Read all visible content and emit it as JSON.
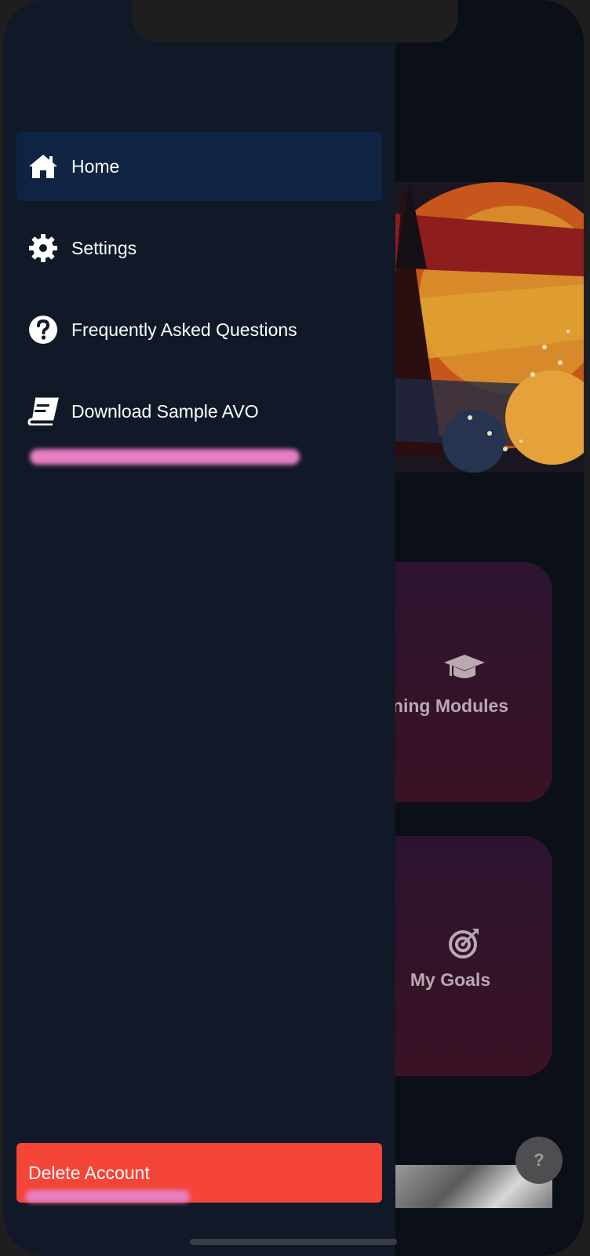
{
  "drawer": {
    "items": [
      {
        "label": "Home",
        "icon": "home-icon",
        "active": true
      },
      {
        "label": "Settings",
        "icon": "gear-icon",
        "active": false
      },
      {
        "label": "Frequently Asked Questions",
        "icon": "question-circle-icon",
        "active": false
      },
      {
        "label": "Download Sample AVO",
        "icon": "book-icon",
        "active": false
      }
    ],
    "delete_label": "Delete Account"
  },
  "background": {
    "cards": [
      {
        "label": "ning Modules",
        "icon": "graduation-cap-icon"
      },
      {
        "label": "My Goals",
        "icon": "target-icon"
      }
    ],
    "help_label": "?"
  },
  "colors": {
    "drawer_bg": "#111827",
    "active_item_bg": "#0f2342",
    "delete_bg": "#f54438",
    "redaction": "#e67fc3"
  }
}
